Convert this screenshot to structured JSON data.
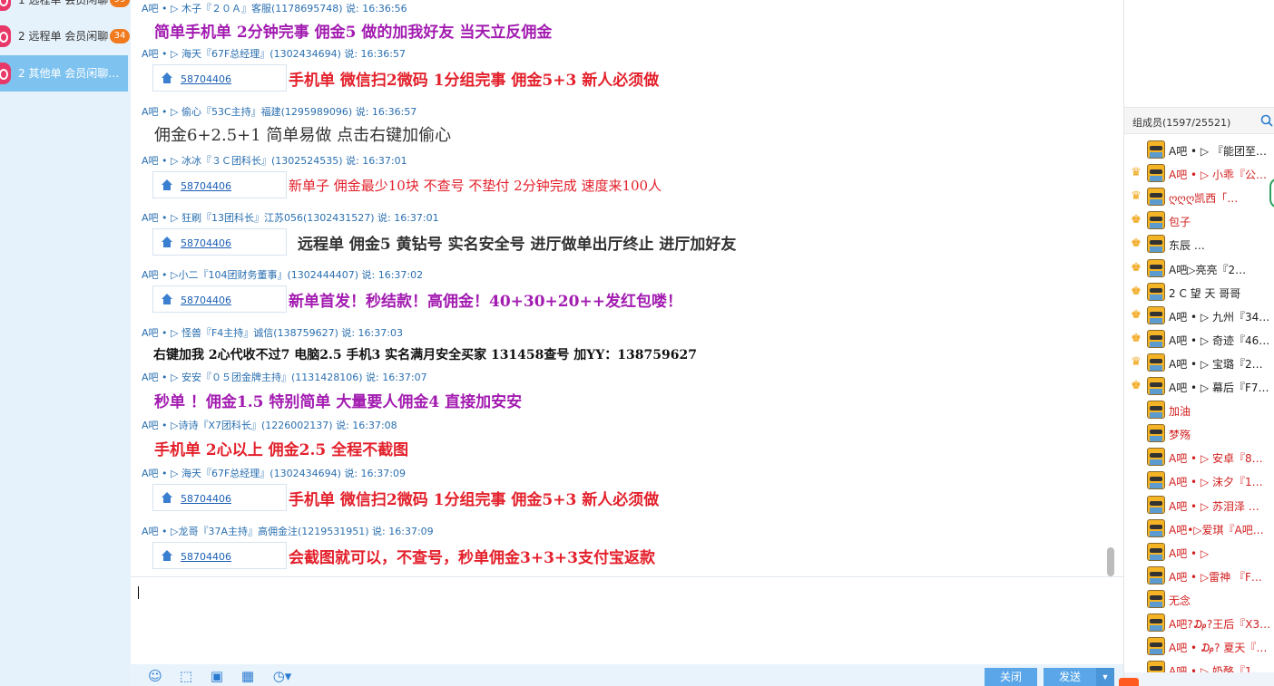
{
  "sidebar": {
    "items": [
      {
        "label": "1 远程单 会员闲聊",
        "badge": "99"
      },
      {
        "label": "2 远程单 会员闲聊",
        "badge": "34"
      },
      {
        "label": "2 其他单 会员闲聊…",
        "badge": ""
      }
    ]
  },
  "chat": {
    "card_number": "58704406",
    "messages": [
      {
        "header": "A吧 • ▷ 木子『２０Ａ』客服(1178695748) 说: 16:36:56",
        "body": "简单手机单  2分钟完事  佣金5   做的加我好友  当天立反佣金",
        "has_card": false
      },
      {
        "header": "A吧 • ▷ 海天『67F总经理』(1302434694) 说: 16:36:57",
        "body": "手机单  微信扫2微码   1分组完事  佣金5+3   新人必须做",
        "has_card": true
      },
      {
        "header": "A吧 • ▷ 偷心『53C主持』福建(1295989096) 说: 16:36:57",
        "body": "佣金6+2.5+1  简单易做   点击右键加偷心",
        "has_card": false
      },
      {
        "header": "A吧 • ▷ 冰冰『３Ｃ团科长』(1302524535) 说: 16:37:01",
        "body": "新单子  佣金最少10块  不查号  不垫付  2分钟完成  速度来100人",
        "has_card": true
      },
      {
        "header": "A吧 • ▷ 狂刷『13团科长』江苏056(1302431527) 说: 16:37:01",
        "body": "远程单    佣金5       黄钻号       实名安全号   进厅做单出厅终止   进厅加好友",
        "has_card": true
      },
      {
        "header": "A吧 • ▷小二『104团财务董事』(1302444407) 说: 16:37:02",
        "body": "新单首发！秒结款！高佣金！40+30+20++发红包喽！",
        "has_card": true
      },
      {
        "header": "A吧 • ▷ 怪兽『F4主持』诚信(138759627) 说: 16:37:03",
        "body": "右键加我 2心代收不过7 电脑2.5 手机3 实名满月安全买家 131458查号 加YY：138759627",
        "has_card": false
      },
      {
        "header": "A吧 • ▷ 安安『０５团金牌主持』(1131428106) 说: 16:37:07",
        "body": "秒单  ！佣金1.5   特别简单  大量要人佣金4   直接加安安",
        "has_card": false
      },
      {
        "header": "A吧 • ▷诗诗『X7团科长』(1226002137) 说: 16:37:08",
        "body": "手机单  2心以上  佣金2.5 全程不截图",
        "has_card": false
      },
      {
        "header": "A吧 • ▷ 海天『67F总经理』(1302434694) 说: 16:37:09",
        "body": "手机单  微信扫2微码   1分组完事  佣金5+3   新人必须做",
        "has_card": true
      },
      {
        "header": "A吧 • ▷龙哥『37A主持』高佣金注(1219531951) 说: 16:37:09",
        "body": "会截图就可以，不查号，秒单佣金3+3+3支付宝返款",
        "has_card": true
      }
    ]
  },
  "toolbar": {
    "close_label": "关闭",
    "send_label": "发送",
    "send_arrow": "▼"
  },
  "members": {
    "title": "组成员(1597/25521)",
    "list": [
      {
        "name": "A吧 • ▷ 『能团至…",
        "icon": "",
        "red": false
      },
      {
        "name": "A吧 • ▷ 小乖『公…",
        "icon": "crown",
        "red": true
      },
      {
        "name": "ღღღ凯西「…",
        "icon": "crown",
        "red": true
      },
      {
        "name": "包子",
        "icon": "gift",
        "red": true
      },
      {
        "name": "东辰      …",
        "icon": "gift",
        "red": false
      },
      {
        "name": "A吧▷亮亮『2…",
        "icon": "gift",
        "red": false
      },
      {
        "name": "2 C 望 天  哥哥",
        "icon": "gift",
        "red": false
      },
      {
        "name": "A吧 • ▷ 九州『34…",
        "icon": "gift",
        "red": false
      },
      {
        "name": "A吧 • ▷ 奇迹『46…",
        "icon": "gift",
        "red": false
      },
      {
        "name": "A吧 • ▷ 宝璐『2…",
        "icon": "crown",
        "red": false
      },
      {
        "name": "A吧 • ▷ 幕后『F7…",
        "icon": "gift",
        "red": false
      },
      {
        "name": "加油",
        "icon": "",
        "red": true
      },
      {
        "name": "梦殇",
        "icon": "",
        "red": true
      },
      {
        "name": "A吧 • ▷ 安卓『8…",
        "icon": "",
        "red": true
      },
      {
        "name": "A吧 • ▷ 沫夕『1…",
        "icon": "",
        "red": true
      },
      {
        "name": "A吧 • ▷ 苏泪泽 …",
        "icon": "",
        "red": true
      },
      {
        "name": "A吧•▷爱琪『A吧…",
        "icon": "",
        "red": true
      },
      {
        "name": "A吧 • ▷",
        "icon": "",
        "red": true
      },
      {
        "name": "A吧 • ▷雷神 『F…",
        "icon": "",
        "red": true
      },
      {
        "name": "无念",
        "icon": "",
        "red": true
      },
      {
        "name": "A吧?₯?王后『X3团…",
        "icon": "",
        "red": true
      },
      {
        "name": "A吧 • ₯? 夏天『H…",
        "icon": "",
        "red": true
      },
      {
        "name": "A吧 • ▷ 奶酪『1…",
        "icon": "",
        "red": true
      }
    ]
  }
}
